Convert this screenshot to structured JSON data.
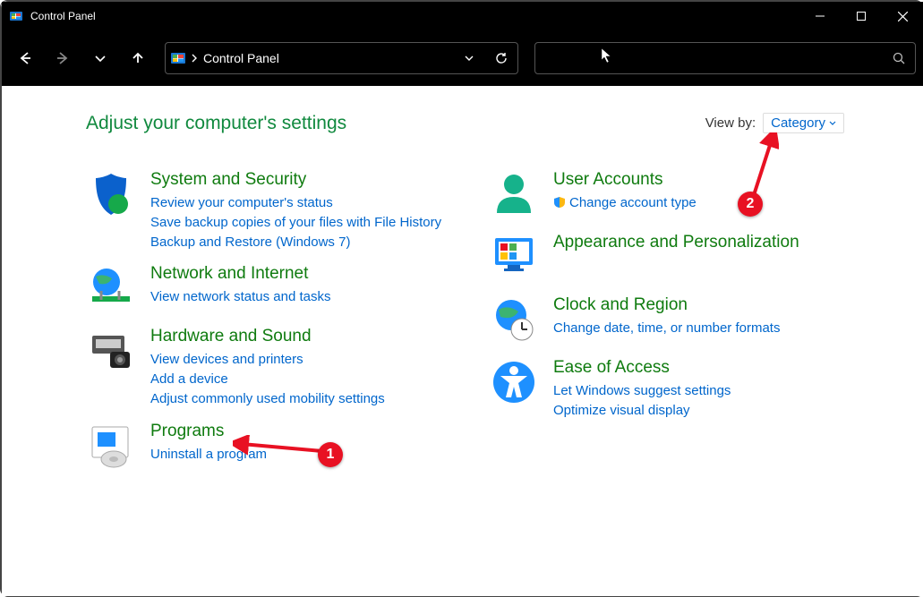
{
  "window": {
    "title": "Control Panel"
  },
  "address": {
    "crumb": "Control Panel"
  },
  "header": {
    "heading": "Adjust your computer's settings",
    "viewby_label": "View by:",
    "viewby_value": "Category"
  },
  "left": [
    {
      "title": "System and Security",
      "links": [
        "Review your computer's status",
        "Save backup copies of your files with File History",
        "Backup and Restore (Windows 7)"
      ]
    },
    {
      "title": "Network and Internet",
      "links": [
        "View network status and tasks"
      ]
    },
    {
      "title": "Hardware and Sound",
      "links": [
        "View devices and printers",
        "Add a device",
        "Adjust commonly used mobility settings"
      ]
    },
    {
      "title": "Programs",
      "links": [
        "Uninstall a program"
      ]
    }
  ],
  "right": [
    {
      "title": "User Accounts",
      "links": [
        "Change account type"
      ],
      "shield_on": [
        0
      ]
    },
    {
      "title": "Appearance and Personalization",
      "links": []
    },
    {
      "title": "Clock and Region",
      "links": [
        "Change date, time, or number formats"
      ]
    },
    {
      "title": "Ease of Access",
      "links": [
        "Let Windows suggest settings",
        "Optimize visual display"
      ]
    }
  ],
  "annotations": {
    "badge1": "1",
    "badge2": "2"
  }
}
